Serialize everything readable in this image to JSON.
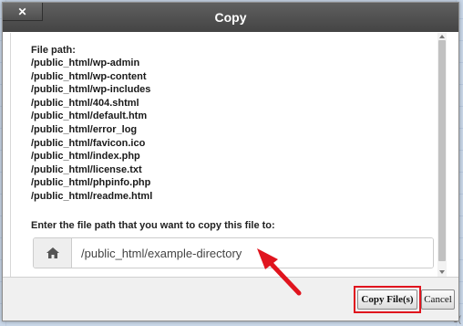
{
  "dialog": {
    "title": "Copy",
    "close_label": "✕"
  },
  "file_path_label": "File path:",
  "files": [
    "/public_html/wp-admin",
    "/public_html/wp-content",
    "/public_html/wp-includes",
    "/public_html/404.shtml",
    "/public_html/default.htm",
    "/public_html/error_log",
    "/public_html/favicon.ico",
    "/public_html/index.php",
    "/public_html/license.txt",
    "/public_html/phpinfo.php",
    "/public_html/readme.html"
  ],
  "destination": {
    "prompt": "Enter the file path that you want to copy this file to:",
    "value": "/public_html/example-directory",
    "addon_icon": "home-icon"
  },
  "buttons": {
    "copy": "Copy File(s)",
    "cancel": "Cancel"
  },
  "annotation": {
    "highlight_color": "#e0141e",
    "arrow_color": "#e0141e"
  },
  "background": {
    "corner_left": "",
    "corner_right": "3("
  }
}
